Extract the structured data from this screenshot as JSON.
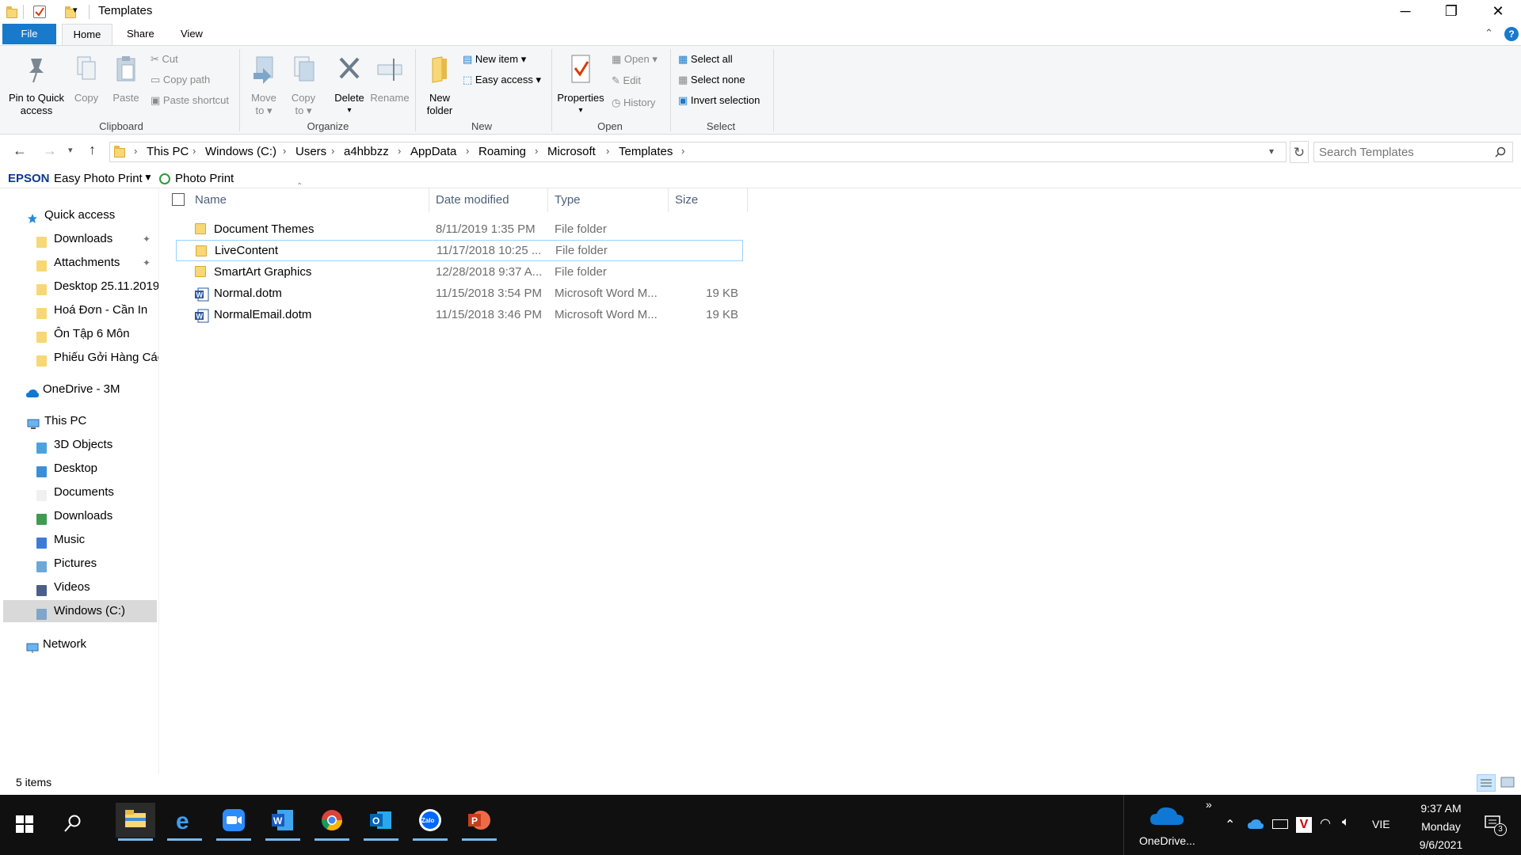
{
  "window": {
    "title": "Templates",
    "controls": {
      "minimize": "─",
      "restore": "❐",
      "close": "✕"
    }
  },
  "ribbon_tabs": [
    "File",
    "Home",
    "Share",
    "View"
  ],
  "ribbon": {
    "clipboard": {
      "label": "Clipboard",
      "pin": "Pin to Quick access",
      "pin_line1": "Pin to Quick",
      "pin_line2": "access",
      "copy": "Copy",
      "paste": "Paste",
      "cut": "Cut",
      "copy_path": "Copy path",
      "paste_shortcut": "Paste shortcut"
    },
    "organize": {
      "label": "Organize",
      "move_to_1": "Move",
      "move_to_2": "to",
      "copy_to_1": "Copy",
      "copy_to_2": "to",
      "delete": "Delete",
      "rename": "Rename"
    },
    "new": {
      "label": "New",
      "new_folder_1": "New",
      "new_folder_2": "folder",
      "new_item": "New item",
      "easy_access": "Easy access"
    },
    "open": {
      "label": "Open",
      "properties": "Properties",
      "open": "Open",
      "edit": "Edit",
      "history": "History"
    },
    "select": {
      "label": "Select",
      "select_all": "Select all",
      "select_none": "Select none",
      "invert_selection": "Invert selection"
    }
  },
  "address": {
    "crumbs": [
      "This PC",
      "Windows (C:)",
      "Users",
      "a4hbbzz",
      "AppData",
      "Roaming",
      "Microsoft",
      "Templates"
    ],
    "search_placeholder": "Search Templates"
  },
  "epson": {
    "brand": "EPSON",
    "app": "Easy Photo Print",
    "photo_print": "Photo Print"
  },
  "nav": {
    "quick_access": "Quick access",
    "quick_items": [
      "Downloads",
      "Attachments",
      "Desktop 25.11.2019",
      "Hoá Đơn - Cần In",
      "Ôn Tập 6 Môn",
      "Phiếu Gởi Hàng Các"
    ],
    "onedrive": "OneDrive - 3M",
    "this_pc": "This PC",
    "pc_items": [
      "3D Objects",
      "Desktop",
      "Documents",
      "Downloads",
      "Music",
      "Pictures",
      "Videos",
      "Windows (C:)"
    ],
    "network": "Network"
  },
  "columns": {
    "name": "Name",
    "date": "Date modified",
    "type": "Type",
    "size": "Size"
  },
  "files": [
    {
      "name": "Document Themes",
      "date": "8/11/2019 1:35 PM",
      "type": "File folder",
      "size": "",
      "icon": "folder"
    },
    {
      "name": "LiveContent",
      "date": "11/17/2018 10:25 ...",
      "type": "File folder",
      "size": "",
      "icon": "folder"
    },
    {
      "name": "SmartArt Graphics",
      "date": "12/28/2018 9:37 A...",
      "type": "File folder",
      "size": "",
      "icon": "folder"
    },
    {
      "name": "Normal.dotm",
      "date": "11/15/2018 3:54 PM",
      "type": "Microsoft Word M...",
      "size": "19 KB",
      "icon": "word"
    },
    {
      "name": "NormalEmail.dotm",
      "date": "11/15/2018 3:46 PM",
      "type": "Microsoft Word M...",
      "size": "19 KB",
      "icon": "word"
    }
  ],
  "status": {
    "items": "5 items"
  },
  "taskbar": {
    "apps": [
      "file-explorer",
      "edge",
      "zoom",
      "word",
      "chrome",
      "outlook",
      "zalo",
      "powerpoint"
    ],
    "zalo_label": "Zalo",
    "onedrive_label": "OneDrive...",
    "overflow": "»",
    "language": "VIE",
    "time": "9:37 AM",
    "day": "Monday",
    "date": "9/6/2021",
    "notifications": "3"
  },
  "colors": {
    "accent": "#1979ca",
    "folder": "#f8d775",
    "taskbar": "#101010",
    "selection_border": "#99d1ff"
  }
}
